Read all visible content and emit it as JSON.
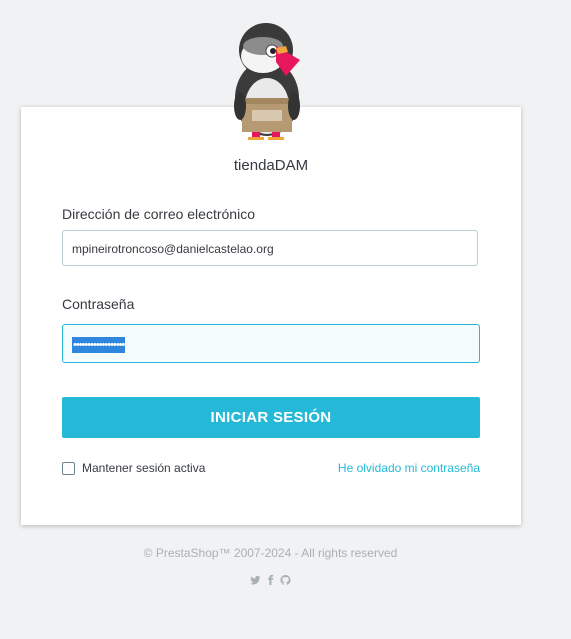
{
  "shop": {
    "name": "tiendaDAM"
  },
  "form": {
    "email_label": "Dirección de correo electrónico",
    "email_value": "mpineirotroncoso@danielcastelao.org",
    "password_label": "Contraseña",
    "password_mask": "••••••••••••••••••",
    "submit_label": "INICIAR SESIÓN",
    "remember_label": "Mantener sesión activa",
    "remember_checked": false,
    "forgot_label": "He olvidado mi contraseña"
  },
  "footer": {
    "copyright": "© PrestaShop™ 2007-2024 - All rights reserved",
    "social_icons": [
      "twitter-icon",
      "facebook-icon",
      "github-icon"
    ]
  },
  "colors": {
    "background": "#f1f2f3",
    "accent": "#25b9d7",
    "text": "#363a41",
    "muted": "#a9b0b4"
  }
}
